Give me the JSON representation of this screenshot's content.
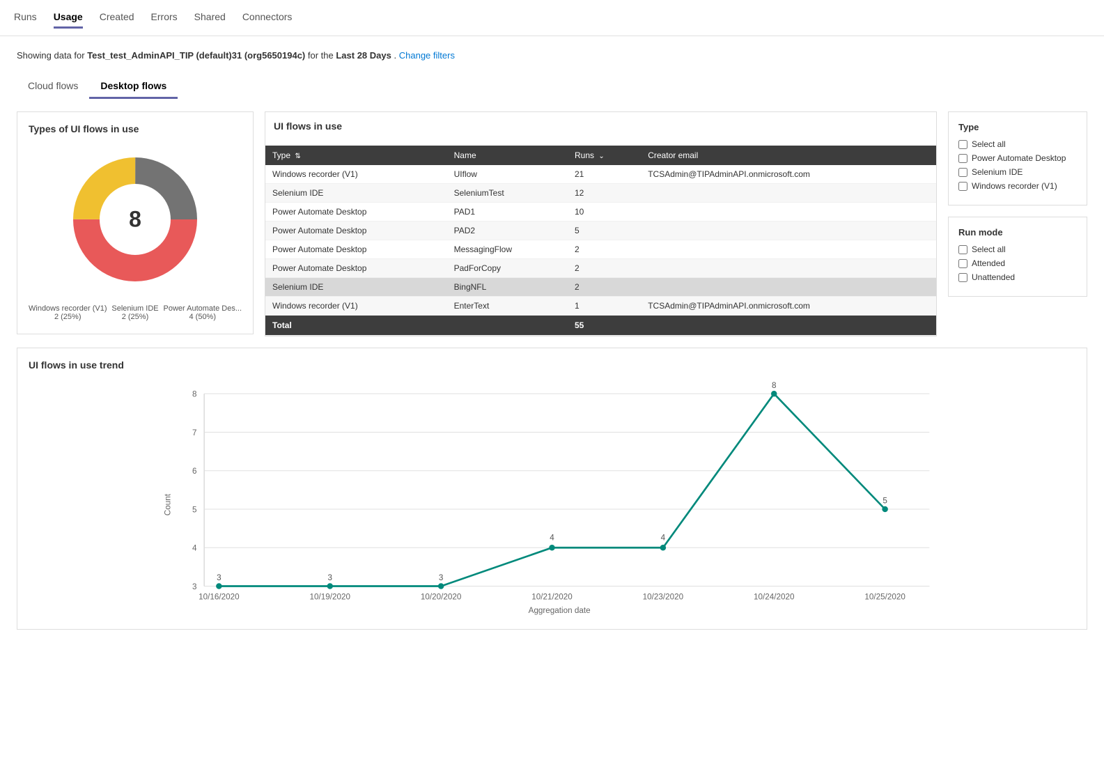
{
  "nav": {
    "items": [
      {
        "label": "Runs",
        "active": false
      },
      {
        "label": "Usage",
        "active": true
      },
      {
        "label": "Created",
        "active": false
      },
      {
        "label": "Errors",
        "active": false
      },
      {
        "label": "Shared",
        "active": false
      },
      {
        "label": "Connectors",
        "active": false
      }
    ]
  },
  "subtitle": {
    "prefix": "Showing data for ",
    "bold": "Test_test_AdminAPI_TIP (default)31 (org5650194c)",
    "middle": " for the ",
    "bold2": "Last 28 Days",
    "suffix": ".",
    "link": "Change filters"
  },
  "flowTabs": {
    "items": [
      {
        "label": "Cloud flows",
        "active": false
      },
      {
        "label": "Desktop flows",
        "active": true
      }
    ]
  },
  "donutChart": {
    "title": "Types of UI flows in use",
    "center": "8",
    "segments": [
      {
        "label": "Windows recorder (V1)",
        "value": "2 (25%)",
        "color": "#737373",
        "percent": 25
      },
      {
        "label": "Power Automate Des...",
        "value": "4 (50%)",
        "color": "#e85959",
        "percent": 50
      },
      {
        "label": "Selenium IDE",
        "value": "2 (25%)",
        "color": "#f0c030",
        "percent": 25
      }
    ]
  },
  "uiFlowsTable": {
    "title": "UI flows in use",
    "headers": [
      {
        "label": "Type",
        "sortable": true
      },
      {
        "label": "Name",
        "sortable": true
      },
      {
        "label": "Runs",
        "sortable": true
      },
      {
        "label": "Creator email",
        "sortable": false
      }
    ],
    "rows": [
      {
        "type": "Windows recorder (V1)",
        "name": "UIflow",
        "runs": "21",
        "email": "TCSAdmin@TIPAdminAPI.onmicrosoft.com",
        "highlight": false
      },
      {
        "type": "Selenium IDE",
        "name": "SeleniumTest",
        "runs": "12",
        "email": "",
        "highlight": false
      },
      {
        "type": "Power Automate Desktop",
        "name": "PAD1",
        "runs": "10",
        "email": "",
        "highlight": false
      },
      {
        "type": "Power Automate Desktop",
        "name": "PAD2",
        "runs": "5",
        "email": "",
        "highlight": false
      },
      {
        "type": "Power Automate Desktop",
        "name": "MessagingFlow",
        "runs": "2",
        "email": "",
        "highlight": false
      },
      {
        "type": "Power Automate Desktop",
        "name": "PadForCopy",
        "runs": "2",
        "email": "",
        "highlight": false
      },
      {
        "type": "Selenium IDE",
        "name": "BingNFL",
        "runs": "2",
        "email": "",
        "highlight": true
      },
      {
        "type": "Windows recorder (V1)",
        "name": "EnterText",
        "runs": "1",
        "email": "TCSAdmin@TIPAdminAPI.onmicrosoft.com",
        "highlight": false
      }
    ],
    "footer": {
      "label": "Total",
      "value": "55"
    }
  },
  "typeFilter": {
    "title": "Type",
    "options": [
      {
        "label": "Select all",
        "checked": false
      },
      {
        "label": "Power Automate Desktop",
        "checked": false
      },
      {
        "label": "Selenium IDE",
        "checked": false
      },
      {
        "label": "Windows recorder (V1)",
        "checked": false
      }
    ]
  },
  "runModeFilter": {
    "title": "Run mode",
    "options": [
      {
        "label": "Select all",
        "checked": false
      },
      {
        "label": "Attended",
        "checked": false
      },
      {
        "label": "Unattended",
        "checked": false
      }
    ]
  },
  "trendChart": {
    "title": "UI flows in use trend",
    "yAxisLabel": "Count",
    "xAxisLabel": "Aggregation date",
    "yMin": 3,
    "yMax": 8,
    "points": [
      {
        "date": "10/16/2020",
        "value": 3
      },
      {
        "date": "10/19/2020",
        "value": 3
      },
      {
        "date": "10/20/2020",
        "value": 3
      },
      {
        "date": "10/21/2020",
        "value": 4
      },
      {
        "date": "10/23/2020",
        "value": 4
      },
      {
        "date": "10/24/2020",
        "value": 8
      },
      {
        "date": "10/25/2020",
        "value": 5
      }
    ],
    "lineColor": "#00897b"
  }
}
